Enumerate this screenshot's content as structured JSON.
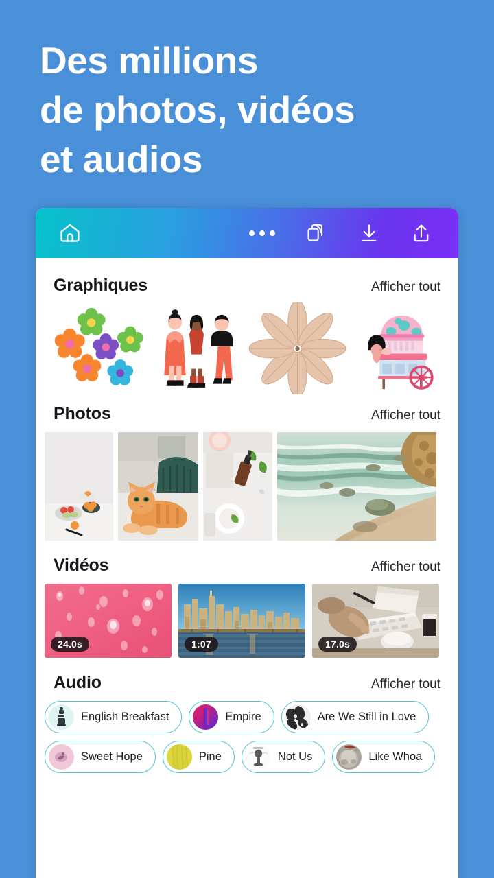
{
  "hero": {
    "lines": [
      "Des millions",
      "de photos, vidéos",
      "et audios"
    ],
    "text_color": "#ffffff",
    "background_color": "#4a90d9"
  },
  "toolbar": {
    "gradient_from": "#05c3c9",
    "gradient_to": "#7b2ff7",
    "items": [
      {
        "name": "home-icon",
        "label": "Accueil"
      },
      {
        "name": "more-icon",
        "label": "Plus"
      },
      {
        "name": "duplicate-icon",
        "label": "Dupliquer"
      },
      {
        "name": "download-icon",
        "label": "Télécharger"
      },
      {
        "name": "share-icon",
        "label": "Partager"
      }
    ]
  },
  "see_all_label": "Afficher tout",
  "sections": {
    "graphics": {
      "title": "Graphiques",
      "see_all": "Afficher tout",
      "items": [
        {
          "name": "flowers-graphic",
          "alt": "Fleurs colorées"
        },
        {
          "name": "three-women-graphic",
          "alt": "Trois femmes en rouge"
        },
        {
          "name": "leaves-graphic",
          "alt": "Feuilles disposées en éventail"
        },
        {
          "name": "food-cart-graphic",
          "alt": "Chariot de nourriture rose"
        }
      ]
    },
    "photos": {
      "title": "Photos",
      "see_all": "Afficher tout",
      "items": [
        {
          "name": "photo-fruit-bowls",
          "alt": "Bols de fruits sur table blanche"
        },
        {
          "name": "photo-orange-cat",
          "alt": "Chat roux allongé"
        },
        {
          "name": "photo-skincare-flatlay",
          "alt": "Produits de soin à plat"
        },
        {
          "name": "photo-beach-waves",
          "alt": "Vagues et plage de sable"
        }
      ]
    },
    "videos": {
      "title": "Vidéos",
      "see_all": "Afficher tout",
      "items": [
        {
          "name": "video-pink-droplets",
          "duration": "24.0s",
          "alt": "Gouttes d'eau sur surface rose"
        },
        {
          "name": "video-city-skyline",
          "duration": "1:07",
          "alt": "Horizon urbain et rivière"
        },
        {
          "name": "video-typing-keyboard",
          "duration": "17.0s",
          "alt": "Mains tapant sur un clavier"
        }
      ]
    },
    "audio": {
      "title": "Audio",
      "see_all": "Afficher tout",
      "rows": [
        [
          {
            "name": "audio-english-breakfast",
            "label": "English Breakfast",
            "thumb": "#d9f3f3"
          },
          {
            "name": "audio-empire",
            "label": "Empire",
            "thumb": "#c01f6a"
          },
          {
            "name": "audio-are-we-still-in-love",
            "label": "Are We Still in Love",
            "thumb": "#3c3c3c"
          }
        ],
        [
          {
            "name": "audio-sweet-hope",
            "label": "Sweet Hope",
            "thumb": "#f2c9d9"
          },
          {
            "name": "audio-pine",
            "label": "Pine",
            "thumb": "#d8d23a"
          },
          {
            "name": "audio-not-us",
            "label": "Not Us",
            "thumb": "#f2f2f2"
          },
          {
            "name": "audio-like-whoa",
            "label": "Like Whoa",
            "thumb": "#a8a49c"
          }
        ]
      ]
    }
  },
  "colors": {
    "chip_border": "#4fc3d4",
    "card_background": "#ffffff",
    "title_color": "#16181c"
  }
}
